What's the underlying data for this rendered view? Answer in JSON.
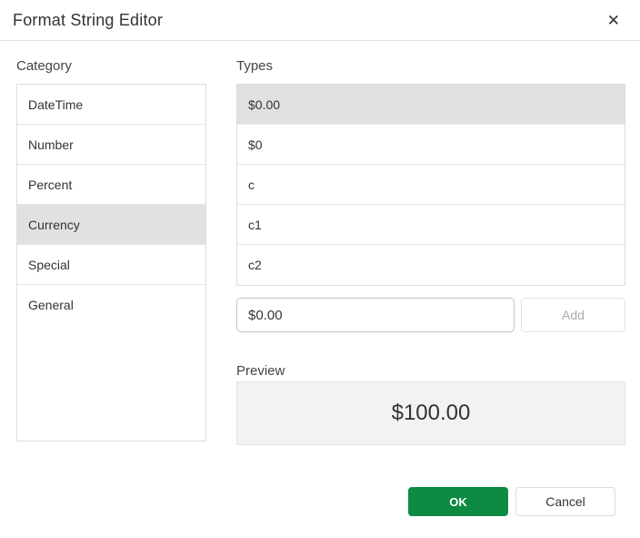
{
  "dialog": {
    "title": "Format String Editor"
  },
  "icons": {
    "close": "✕"
  },
  "category": {
    "label": "Category",
    "items": [
      {
        "label": "DateTime",
        "selected": false
      },
      {
        "label": "Number",
        "selected": false
      },
      {
        "label": "Percent",
        "selected": false
      },
      {
        "label": "Currency",
        "selected": true
      },
      {
        "label": "Special",
        "selected": false
      },
      {
        "label": "General",
        "selected": false
      }
    ]
  },
  "types": {
    "label": "Types",
    "items": [
      {
        "label": "$0.00",
        "selected": true
      },
      {
        "label": "$0",
        "selected": false
      },
      {
        "label": "c",
        "selected": false
      },
      {
        "label": "c1",
        "selected": false
      },
      {
        "label": "c2",
        "selected": false
      }
    ]
  },
  "format_input": {
    "value": "$0.00"
  },
  "add_button": {
    "label": "Add",
    "disabled": true
  },
  "preview": {
    "label": "Preview",
    "value": "$100.00"
  },
  "footer": {
    "ok_label": "OK",
    "cancel_label": "Cancel"
  },
  "colors": {
    "accent_green": "#0e8b43",
    "selected_row_bg": "#e1e1e1",
    "preview_bg": "#f2f2f2"
  }
}
